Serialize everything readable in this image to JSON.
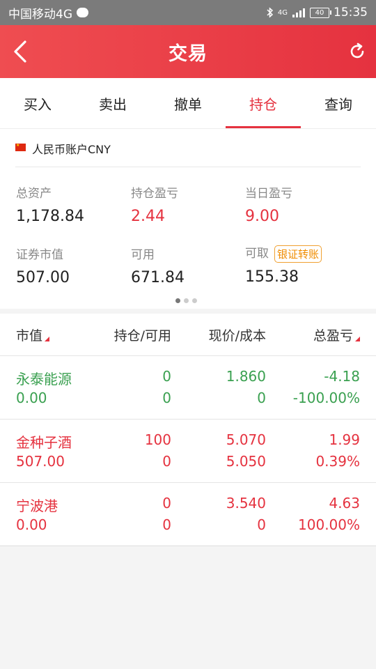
{
  "status_bar": {
    "carrier": "中国移动4G",
    "network": "4G",
    "battery": "40",
    "time": "15:35"
  },
  "header": {
    "title": "交易"
  },
  "tabs": [
    {
      "label": "买入",
      "active": false
    },
    {
      "label": "卖出",
      "active": false
    },
    {
      "label": "撤单",
      "active": false
    },
    {
      "label": "持仓",
      "active": true
    },
    {
      "label": "查询",
      "active": false
    }
  ],
  "account": {
    "name": "人民币账户CNY",
    "total_assets_label": "总资产",
    "total_assets": "1,178.84",
    "position_pnl_label": "持仓盈亏",
    "position_pnl": "2.44",
    "daily_pnl_label": "当日盈亏",
    "daily_pnl": "9.00",
    "market_value_label": "证券市值",
    "market_value": "507.00",
    "available_label": "可用",
    "available": "671.84",
    "withdrawable_label": "可取",
    "withdrawable": "155.38",
    "transfer_label": "银证转账"
  },
  "table": {
    "headers": [
      "市值",
      "持仓/可用",
      "现价/成本",
      "总盈亏"
    ],
    "rows": [
      {
        "name": "永泰能源",
        "market_value": "0.00",
        "holding": "0",
        "available": "0",
        "price": "1.860",
        "cost": "0",
        "pnl": "-4.18",
        "pnl_pct": "-100.00%",
        "color": "green"
      },
      {
        "name": "金种子酒",
        "market_value": "507.00",
        "holding": "100",
        "available": "0",
        "price": "5.070",
        "cost": "5.050",
        "pnl": "1.99",
        "pnl_pct": "0.39%",
        "color": "red"
      },
      {
        "name": "宁波港",
        "market_value": "0.00",
        "holding": "0",
        "available": "0",
        "price": "3.540",
        "cost": "0",
        "pnl": "4.63",
        "pnl_pct": "100.00%",
        "color": "red"
      }
    ]
  },
  "colors": {
    "accent": "#e5323f",
    "gain": "#e5323f",
    "loss": "#3aa050",
    "badge": "#f08c00"
  }
}
